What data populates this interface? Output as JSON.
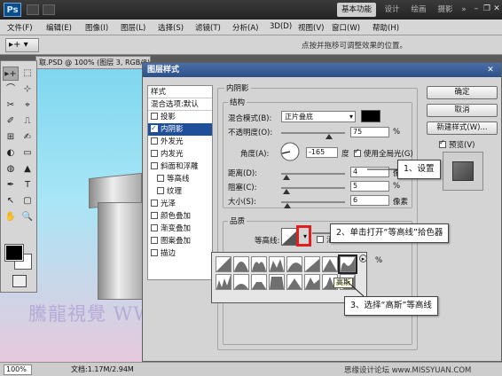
{
  "app": {
    "logo": "Ps"
  },
  "workspace": {
    "basic": "基本功能",
    "design": "设计",
    "paint": "绘画",
    "photo": "摄影",
    "more": "»"
  },
  "window_controls": {
    "minimize": "–",
    "restore": "❐",
    "close": "✕"
  },
  "menu": [
    "文件(F)",
    "编辑(E)",
    "图像(I)",
    "图层(L)",
    "选择(S)",
    "滤镜(T)",
    "分析(A)",
    "3D(D)",
    "视图(V)",
    "窗口(W)",
    "帮助(H)"
  ],
  "options": {
    "tool": "▸+ ▾",
    "hint": "点按并拖移可调整效果的位置。"
  },
  "document": {
    "tab": "取.PSD @ 100% (图层 3, RGB/8)",
    "zoom": "100%",
    "info": "文档:1.17M/2.94M"
  },
  "watermark": "騰龍視覺 WWW.TLVI.NET",
  "site_credit": "思缘设计论坛 www.MISSYUAN.COM",
  "dialog": {
    "title": "图层样式",
    "close": "✕",
    "styles_header": "样式",
    "blend_options": "混合选项:默认",
    "effects": [
      {
        "label": "投影",
        "checked": false,
        "selected": false,
        "indent": false
      },
      {
        "label": "内阴影",
        "checked": true,
        "selected": true,
        "indent": false
      },
      {
        "label": "外发光",
        "checked": false,
        "selected": false,
        "indent": false
      },
      {
        "label": "内发光",
        "checked": false,
        "selected": false,
        "indent": false
      },
      {
        "label": "斜面和浮雕",
        "checked": false,
        "selected": false,
        "indent": false
      },
      {
        "label": "等高线",
        "checked": false,
        "selected": false,
        "indent": true
      },
      {
        "label": "纹理",
        "checked": false,
        "selected": false,
        "indent": true
      },
      {
        "label": "光泽",
        "checked": false,
        "selected": false,
        "indent": false
      },
      {
        "label": "颜色叠加",
        "checked": false,
        "selected": false,
        "indent": false
      },
      {
        "label": "渐变叠加",
        "checked": false,
        "selected": false,
        "indent": false
      },
      {
        "label": "图案叠加",
        "checked": false,
        "selected": false,
        "indent": false
      },
      {
        "label": "描边",
        "checked": false,
        "selected": false,
        "indent": false
      }
    ],
    "inner_shadow": {
      "section_title": "内阴影",
      "structure_title": "结构",
      "blend_mode_label": "混合模式(B):",
      "blend_mode_value": "正片叠底",
      "shadow_color": "#000000",
      "opacity_label": "不透明度(O):",
      "opacity_value": "75",
      "opacity_level": 0.75,
      "percent": "%",
      "angle_label": "角度(A):",
      "angle_value": "-165",
      "angle_unit": "度",
      "global_light_label": "使用全局光(G)",
      "global_light_checked": true,
      "distance_label": "距离(D):",
      "distance_value": "4",
      "choke_label": "阻塞(C):",
      "choke_value": "5",
      "size_label": "大小(S):",
      "size_value": "6",
      "px": "像素",
      "quality_title": "品质",
      "contour_label": "等高线:",
      "anti_alias_label": "消",
      "noise_percent": "%"
    },
    "buttons": {
      "ok": "确定",
      "cancel": "取消",
      "new_style": "新建样式(W)...",
      "preview": "预览(V)"
    },
    "preview_checked": true,
    "contour_menu_arrow": "▸",
    "tooltip": "高斯"
  },
  "callouts": {
    "step1": "1、设置",
    "step2": "2、单击打开“等高线”拾色器",
    "step3": "3、选择“高斯”等高线"
  },
  "tools": [
    "▸+",
    "⬚",
    "⌒",
    "⊹",
    "✂",
    "⌖",
    "✐",
    "⎍",
    "⊞",
    "✍",
    "◐",
    "▭",
    "◍",
    "▲",
    "✒",
    "T",
    "↖",
    "▢",
    "✋",
    "🔍"
  ]
}
